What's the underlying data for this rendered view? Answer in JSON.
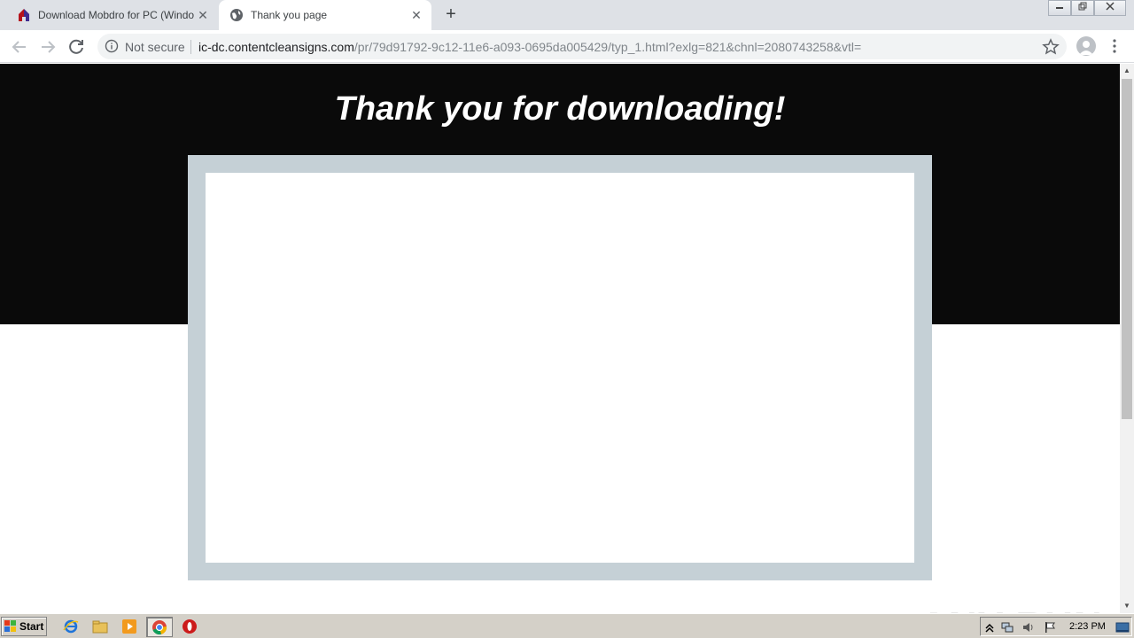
{
  "browser": {
    "tabs": [
      {
        "title": "Download Mobdro for PC (Windows)",
        "active": false
      },
      {
        "title": "Thank you page",
        "active": true
      }
    ],
    "new_tab_label": "+",
    "close_glyph": "✕",
    "omnibox": {
      "security_label": "Not secure",
      "url_host": "ic-dc.contentcleansigns.com",
      "url_path": "/pr/79d91792-9c12-11e6-a093-0695da005429/typ_1.html?exlg=821&chnl=2080743258&vtl="
    },
    "icons": {
      "back": "arrow-left-icon",
      "forward": "arrow-right-icon",
      "reload": "reload-icon",
      "info": "info-icon",
      "bookmark": "star-icon",
      "profile": "account-icon",
      "menu": "kebab-menu-icon"
    }
  },
  "page": {
    "headline": "Thank you for downloading!",
    "hero_color": "#0a0a0a",
    "frame_color": "#c5d0d6"
  },
  "watermark": "ANY RUN",
  "taskbar": {
    "start_label": "Start",
    "clock": "2:23 PM",
    "pinned": [
      "internet-explorer-icon",
      "folder-icon",
      "media-player-icon",
      "chrome-icon",
      "opera-icon"
    ],
    "tray": [
      "chevron-up-icon",
      "network-icon",
      "volume-icon",
      "flag-icon",
      "show-desktop-icon"
    ]
  }
}
